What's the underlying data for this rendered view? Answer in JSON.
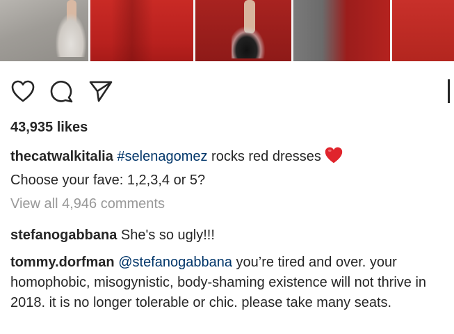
{
  "post": {
    "likes": "43,935 likes",
    "caption": {
      "username": "thecatwalkitalia",
      "hashtag": "#selenagomez",
      "text_line1": " rocks red dresses",
      "text_line2": "Choose your fave: 1,2,3,4 or 5?"
    },
    "view_all_comments": "View all 4,946 comments"
  },
  "comments": [
    {
      "username": "stefanogabbana",
      "text": " She's so ugly!!!"
    },
    {
      "username": "tommy.dorfman",
      "mention": "@stefanogabbana",
      "text": " you’re tired and over. your homophobic, misogynistic, body-shaming existence will not thrive in 2018. it is no longer tolerable or chic. please take many seats."
    }
  ],
  "icons": {
    "like": "heart-outline-icon",
    "comment": "comment-bubble-icon",
    "share": "paper-plane-icon",
    "save": "bookmark-icon",
    "emoji": "red-heart-emoji"
  },
  "colors": {
    "text": "#262626",
    "link": "#003569",
    "muted": "#999999",
    "emoji_heart": "#e0242c"
  }
}
